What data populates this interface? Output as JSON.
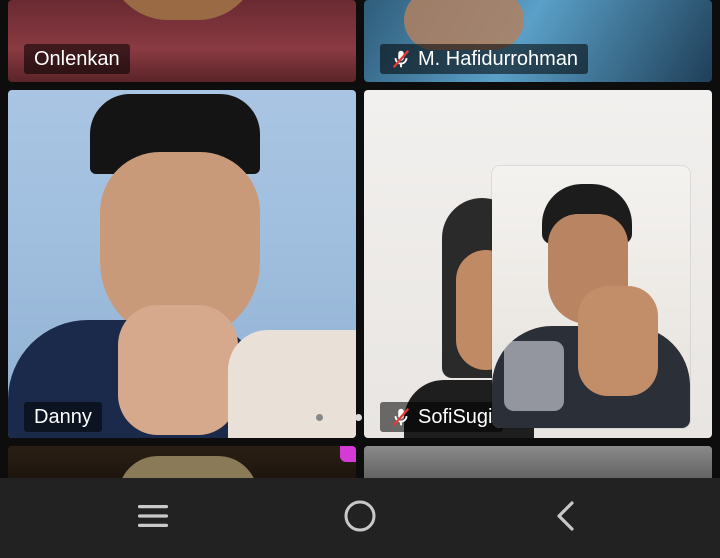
{
  "participants": [
    {
      "name": "Onlenkan",
      "muted": false
    },
    {
      "name": "M. Hafidurrohman",
      "muted": true
    },
    {
      "name": "Danny",
      "muted": false
    },
    {
      "name": "SofiSugi",
      "muted": true
    }
  ],
  "icons": {
    "mic_off": "mic-off-icon",
    "recents": "recents-icon",
    "home": "home-icon",
    "back": "back-icon"
  },
  "colors": {
    "navbar": "#222222",
    "label_bg": "rgba(0,0,0,0.55)",
    "mute_red": "#e53935"
  },
  "pager": {
    "pages": 2,
    "current": 2
  }
}
